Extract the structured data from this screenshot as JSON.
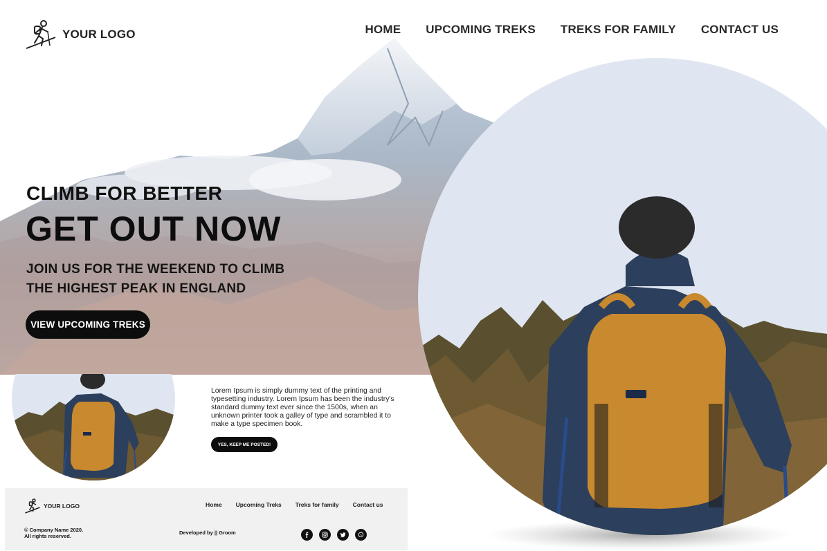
{
  "header": {
    "logo_text": "YOUR LOGO",
    "nav": [
      "HOME",
      "UPCOMING TREKS",
      "TREKS FOR FAMILY",
      "CONTACT US"
    ]
  },
  "hero": {
    "kicker": "CLIMB FOR BETTER",
    "title": "GET OUT NOW",
    "subtitle_line1": "JOIN US FOR THE WEEKEND TO CLIMB",
    "subtitle_line2": "THE HIGHEST PEAK IN ENGLAND",
    "cta": "VIEW UPCOMING TREKS"
  },
  "info": {
    "body": "Lorem Ipsum is simply dummy text of the printing and typesetting industry. Lorem Ipsum has been the industry's standard dummy text ever since the 1500s, when an unknown printer took a galley of type and scrambled it to make a type specimen book.",
    "button": "YES, KEEP ME POSTED!"
  },
  "footer": {
    "logo_text": "YOUR LOGO",
    "nav": [
      "Home",
      "Upcoming Treks",
      "Treks for family",
      "Contact us"
    ],
    "copyright_line1": "© Company Name 2020.",
    "copyright_line2": "All rights reserved.",
    "developed_by": "Developed by || Groom",
    "social_icons": [
      "facebook-icon",
      "instagram-icon",
      "twitter-icon",
      "whatsapp-icon"
    ]
  },
  "colors": {
    "sky": "#dfe6f1",
    "accent_dark": "#0d0d0d",
    "backpack": "#c9892e",
    "jacket": "#2c3f5c",
    "footer_bg": "#f1f1f1"
  }
}
